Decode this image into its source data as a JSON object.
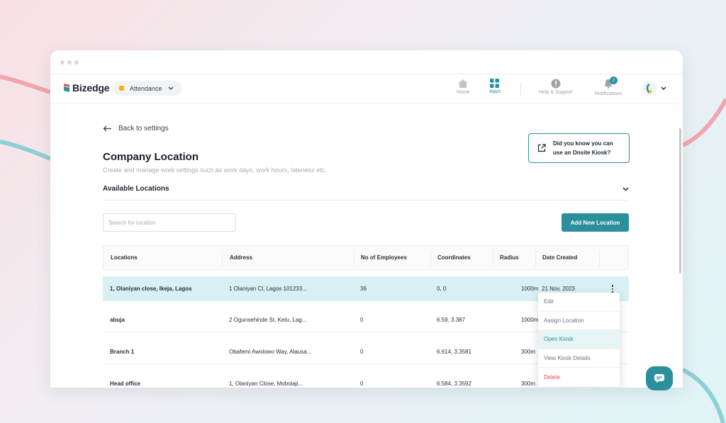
{
  "colors": {
    "accent": "#2b8f9e",
    "danger": "#e5484d",
    "active_row": "#d8eff3"
  },
  "brand": {
    "name": "Bizedge"
  },
  "app_switcher": {
    "label": "Attendance",
    "icon": "chevron-down-icon"
  },
  "nav": {
    "home": "Home",
    "apps": "Apps",
    "help": "Help & Support",
    "notifications": "Notifications",
    "notification_count": "2"
  },
  "back": {
    "label": "Back to settings"
  },
  "page": {
    "title": "Company Location",
    "subtitle": "Create and manage work settings such as work days, work hours, lateness etc."
  },
  "kiosk_card": {
    "line1": "Did you know you can",
    "line2": "use an Onsite Kiosk?"
  },
  "section": {
    "label": "Available Locations"
  },
  "search": {
    "placeholder": "Search for location"
  },
  "add_button": {
    "label": "Add New Location"
  },
  "table": {
    "headers": [
      "Locations",
      "Address",
      "No of Employees",
      "Coordinates",
      "Radius",
      "Date Created"
    ],
    "rows": [
      {
        "location": "1, Olaniyan close, Ikeja, Lagos",
        "address": "1 Olaniyan Cl, Lagos 101233...",
        "employees": "36",
        "coordinates": "0, 0",
        "radius": "1000m",
        "date": "21 Nov, 2023"
      },
      {
        "location": "abuja",
        "address": "2 Ogunsehinde St, Ketu, Lag...",
        "employees": "0",
        "coordinates": "6.59, 3.387",
        "radius": "1000m",
        "date": ""
      },
      {
        "location": "Branch 1",
        "address": "Obafemi Awolowo Way, Alausa...",
        "employees": "0",
        "coordinates": "6.614, 3.3581",
        "radius": "300m",
        "date": ""
      },
      {
        "location": "Head office",
        "address": "1, Olaniyan Close, Mobolaji...",
        "employees": "0",
        "coordinates": "6.584, 3.3592",
        "radius": "300m",
        "date": ""
      }
    ]
  },
  "row_menu": {
    "items": [
      "Edit",
      "Assign Location",
      "Open Kiosk",
      "View Kiosk Details",
      "Delete"
    ],
    "highlighted": "Open Kiosk"
  }
}
